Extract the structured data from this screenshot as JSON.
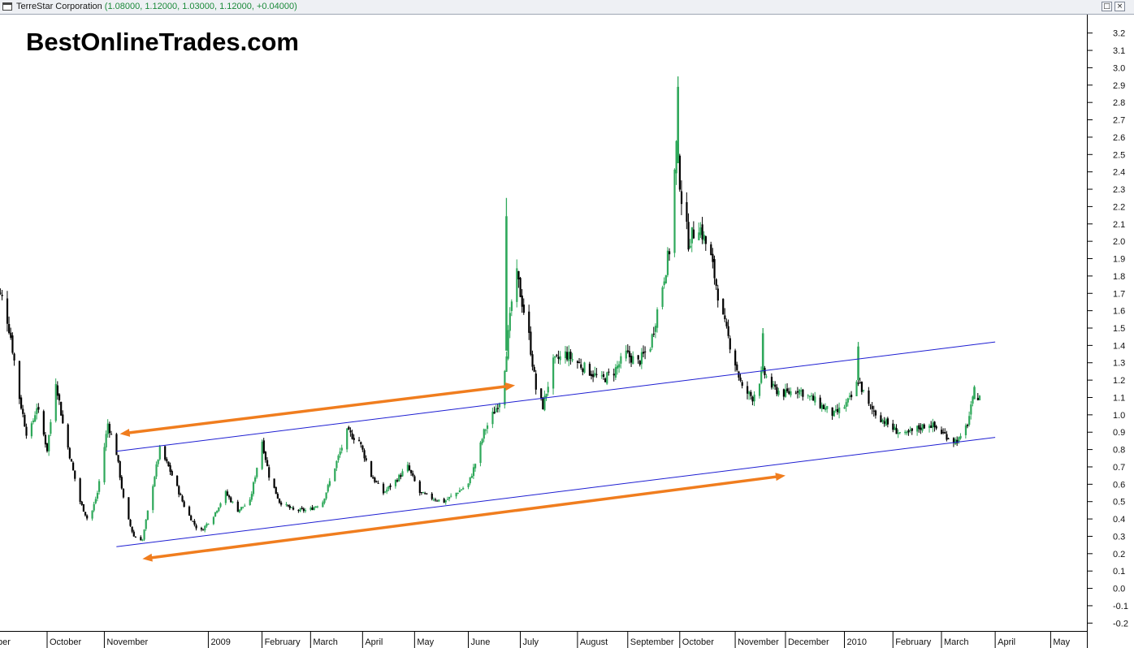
{
  "window": {
    "title": "TerreStar Corporation",
    "quote": "(1.08000, 1.12000, 1.03000, 1.12000, +0.04000)",
    "restore_label": "□",
    "close_label": "×"
  },
  "watermark": "BestOnlineTrades.com",
  "colors": {
    "up_candle": "#2ea85a",
    "down_candle": "#000000",
    "trendline": "#1e1ed2",
    "arrow": "#f07d1e",
    "axis": "#000000"
  },
  "chart_data": {
    "type": "candlestick",
    "symbol": "TerreStar Corporation",
    "ylim": [
      -0.25,
      3.25
    ],
    "yticks": [
      3.2,
      3.1,
      3.0,
      2.9,
      2.8,
      2.7,
      2.6,
      2.5,
      2.4,
      2.3,
      2.2,
      2.1,
      2.0,
      1.9,
      1.8,
      1.7,
      1.6,
      1.5,
      1.4,
      1.3,
      1.2,
      1.1,
      1.0,
      0.9,
      0.8,
      0.7,
      0.6,
      0.5,
      0.4,
      0.3,
      0.2,
      0.1,
      0.0,
      -0.1,
      -0.2
    ],
    "ytick_labels": [
      "3.2",
      "3.1",
      "3.0",
      "2.9",
      "2.8",
      "2.7",
      "2.6",
      "2.5",
      "2.4",
      "2.3",
      "2.2",
      "2.1",
      "2.0",
      "1.9",
      "1.8",
      "1.7",
      "1.6",
      "1.5",
      "1.4",
      "1.3",
      "1.2",
      "1.1",
      "1.0",
      "0.9",
      "0.8",
      "0.7",
      "0.6",
      "0.5",
      "0.4",
      "0.3",
      "0.2",
      "0.1",
      "0.0",
      "-0.1",
      "-0.2"
    ],
    "xlim": [
      "2008-09-01",
      "2010-05-15"
    ],
    "month_labels": [
      {
        "label": "ber",
        "date": "2008-09-01"
      },
      {
        "label": "October",
        "date": "2008-10-01"
      },
      {
        "label": "November",
        "date": "2008-11-03"
      },
      {
        "label": "2009",
        "date": "2009-01-02"
      },
      {
        "label": "February",
        "date": "2009-02-02"
      },
      {
        "label": "March",
        "date": "2009-03-02"
      },
      {
        "label": "April",
        "date": "2009-04-01"
      },
      {
        "label": "May",
        "date": "2009-05-01"
      },
      {
        "label": "June",
        "date": "2009-06-01"
      },
      {
        "label": "July",
        "date": "2009-07-01"
      },
      {
        "label": "August",
        "date": "2009-08-03"
      },
      {
        "label": "September",
        "date": "2009-09-01"
      },
      {
        "label": "October",
        "date": "2009-10-01"
      },
      {
        "label": "November",
        "date": "2009-11-02"
      },
      {
        "label": "December",
        "date": "2009-12-01"
      },
      {
        "label": "2010",
        "date": "2010-01-04"
      },
      {
        "label": "February",
        "date": "2010-02-01"
      },
      {
        "label": "March",
        "date": "2010-03-01"
      },
      {
        "label": "April",
        "date": "2010-04-01"
      },
      {
        "label": "May",
        "date": "2010-05-03"
      }
    ],
    "close_path": [
      [
        "2008-09-01",
        1.75
      ],
      [
        "2008-09-06",
        1.65
      ],
      [
        "2008-09-10",
        1.45
      ],
      [
        "2008-09-15",
        1.1
      ],
      [
        "2008-09-20",
        0.85
      ],
      [
        "2008-09-25",
        1.05
      ],
      [
        "2008-10-01",
        0.8
      ],
      [
        "2008-10-06",
        1.2
      ],
      [
        "2008-10-10",
        0.95
      ],
      [
        "2008-10-15",
        0.72
      ],
      [
        "2008-10-20",
        0.5
      ],
      [
        "2008-10-25",
        0.38
      ],
      [
        "2008-10-30",
        0.55
      ],
      [
        "2008-11-05",
        0.95
      ],
      [
        "2008-11-10",
        0.78
      ],
      [
        "2008-11-15",
        0.45
      ],
      [
        "2008-11-20",
        0.3
      ],
      [
        "2008-11-25",
        0.28
      ],
      [
        "2008-11-30",
        0.55
      ],
      [
        "2008-12-05",
        0.8
      ],
      [
        "2008-12-10",
        0.7
      ],
      [
        "2008-12-15",
        0.58
      ],
      [
        "2008-12-20",
        0.45
      ],
      [
        "2008-12-28",
        0.32
      ],
      [
        "2009-01-05",
        0.42
      ],
      [
        "2009-01-12",
        0.55
      ],
      [
        "2009-01-19",
        0.45
      ],
      [
        "2009-01-26",
        0.5
      ],
      [
        "2009-02-02",
        0.85
      ],
      [
        "2009-02-06",
        0.65
      ],
      [
        "2009-02-12",
        0.5
      ],
      [
        "2009-02-20",
        0.45
      ],
      [
        "2009-03-01",
        0.45
      ],
      [
        "2009-03-09",
        0.5
      ],
      [
        "2009-03-16",
        0.7
      ],
      [
        "2009-03-23",
        0.9
      ],
      [
        "2009-03-30",
        0.85
      ],
      [
        "2009-04-06",
        0.65
      ],
      [
        "2009-04-13",
        0.55
      ],
      [
        "2009-04-20",
        0.62
      ],
      [
        "2009-04-27",
        0.7
      ],
      [
        "2009-05-04",
        0.55
      ],
      [
        "2009-05-11",
        0.52
      ],
      [
        "2009-05-18",
        0.5
      ],
      [
        "2009-05-25",
        0.55
      ],
      [
        "2009-06-01",
        0.6
      ],
      [
        "2009-06-06",
        0.75
      ],
      [
        "2009-06-10",
        0.9
      ],
      [
        "2009-06-15",
        1.0
      ],
      [
        "2009-06-20",
        1.1
      ],
      [
        "2009-06-25",
        1.55
      ],
      [
        "2009-06-28",
        1.85
      ],
      [
        "2009-07-02",
        1.65
      ],
      [
        "2009-07-06",
        1.45
      ],
      [
        "2009-07-10",
        1.15
      ],
      [
        "2009-07-14",
        1.05
      ],
      [
        "2009-07-20",
        1.3
      ],
      [
        "2009-07-27",
        1.35
      ],
      [
        "2009-08-03",
        1.3
      ],
      [
        "2009-08-10",
        1.25
      ],
      [
        "2009-08-17",
        1.2
      ],
      [
        "2009-08-24",
        1.25
      ],
      [
        "2009-08-31",
        1.35
      ],
      [
        "2009-09-07",
        1.3
      ],
      [
        "2009-09-14",
        1.4
      ],
      [
        "2009-09-21",
        1.75
      ],
      [
        "2009-09-25",
        1.95
      ],
      [
        "2009-09-29",
        2.55
      ],
      [
        "2009-10-02",
        2.25
      ],
      [
        "2009-10-06",
        2.0
      ],
      [
        "2009-10-12",
        2.1
      ],
      [
        "2009-10-19",
        1.9
      ],
      [
        "2009-10-26",
        1.55
      ],
      [
        "2009-11-02",
        1.3
      ],
      [
        "2009-11-06",
        1.15
      ],
      [
        "2009-11-12",
        1.1
      ],
      [
        "2009-11-18",
        1.25
      ],
      [
        "2009-11-24",
        1.15
      ],
      [
        "2009-12-01",
        1.12
      ],
      [
        "2009-12-08",
        1.15
      ],
      [
        "2009-12-15",
        1.1
      ],
      [
        "2009-12-22",
        1.05
      ],
      [
        "2009-12-29",
        1.0
      ],
      [
        "2010-01-04",
        1.05
      ],
      [
        "2010-01-08",
        1.1
      ],
      [
        "2010-01-12",
        1.2
      ],
      [
        "2010-01-18",
        1.05
      ],
      [
        "2010-01-25",
        0.98
      ],
      [
        "2010-02-01",
        0.92
      ],
      [
        "2010-02-08",
        0.88
      ],
      [
        "2010-02-15",
        0.92
      ],
      [
        "2010-02-22",
        0.95
      ],
      [
        "2010-03-01",
        0.9
      ],
      [
        "2010-03-08",
        0.85
      ],
      [
        "2010-03-12",
        0.86
      ],
      [
        "2010-03-16",
        0.95
      ],
      [
        "2010-03-19",
        1.08
      ],
      [
        "2010-03-23",
        1.12
      ]
    ],
    "spikes": [
      {
        "date": "2009-06-23",
        "high": 2.25
      },
      {
        "date": "2009-09-30",
        "high": 2.95
      },
      {
        "date": "2009-11-18",
        "high": 1.5
      },
      {
        "date": "2010-01-12",
        "high": 1.42
      },
      {
        "date": "2010-03-20",
        "high": 1.17
      }
    ],
    "trendlines": [
      {
        "name": "upper",
        "start": [
          "2008-11-10",
          0.79
        ],
        "end": [
          "2010-04-01",
          1.42
        ]
      },
      {
        "name": "lower",
        "start": [
          "2008-11-10",
          0.24
        ],
        "end": [
          "2010-04-01",
          0.87
        ]
      }
    ],
    "arrows": [
      {
        "name": "upper-arrow",
        "start": [
          "2008-11-12",
          0.89
        ],
        "end": [
          "2009-06-28",
          1.17
        ]
      },
      {
        "name": "lower-arrow",
        "start": [
          "2008-11-25",
          0.17
        ],
        "end": [
          "2009-12-01",
          0.65
        ]
      }
    ]
  }
}
